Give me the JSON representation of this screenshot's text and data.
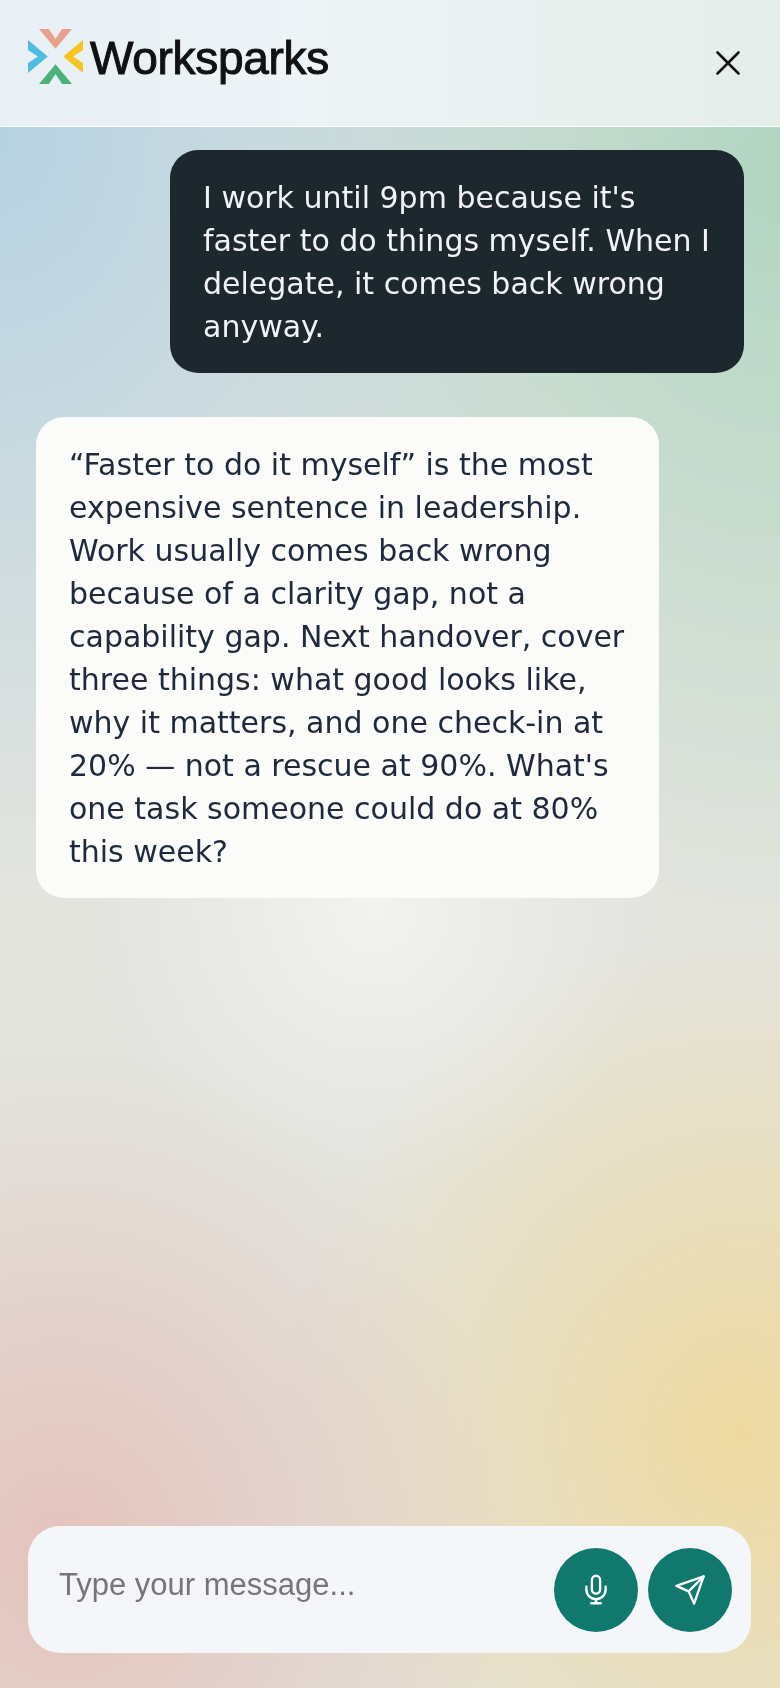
{
  "header": {
    "brand": "Worksparks"
  },
  "messages": [
    {
      "kind": "user",
      "text": "I work until 9pm because it's faster to do things myself. When I delegate, it comes back wrong anyway."
    },
    {
      "kind": "assistant",
      "text": "“Faster to do it myself” is the most expensive sentence in leadership. Work usually comes back wrong because of a clarity gap, not a capability gap. Next handover, cover three things: what good looks like, why it matters, and one check-in at 20% — not a rescue at 90%. What's one task someone could do at 80% this week?"
    }
  ],
  "composer": {
    "placeholder": "Type your message..."
  }
}
